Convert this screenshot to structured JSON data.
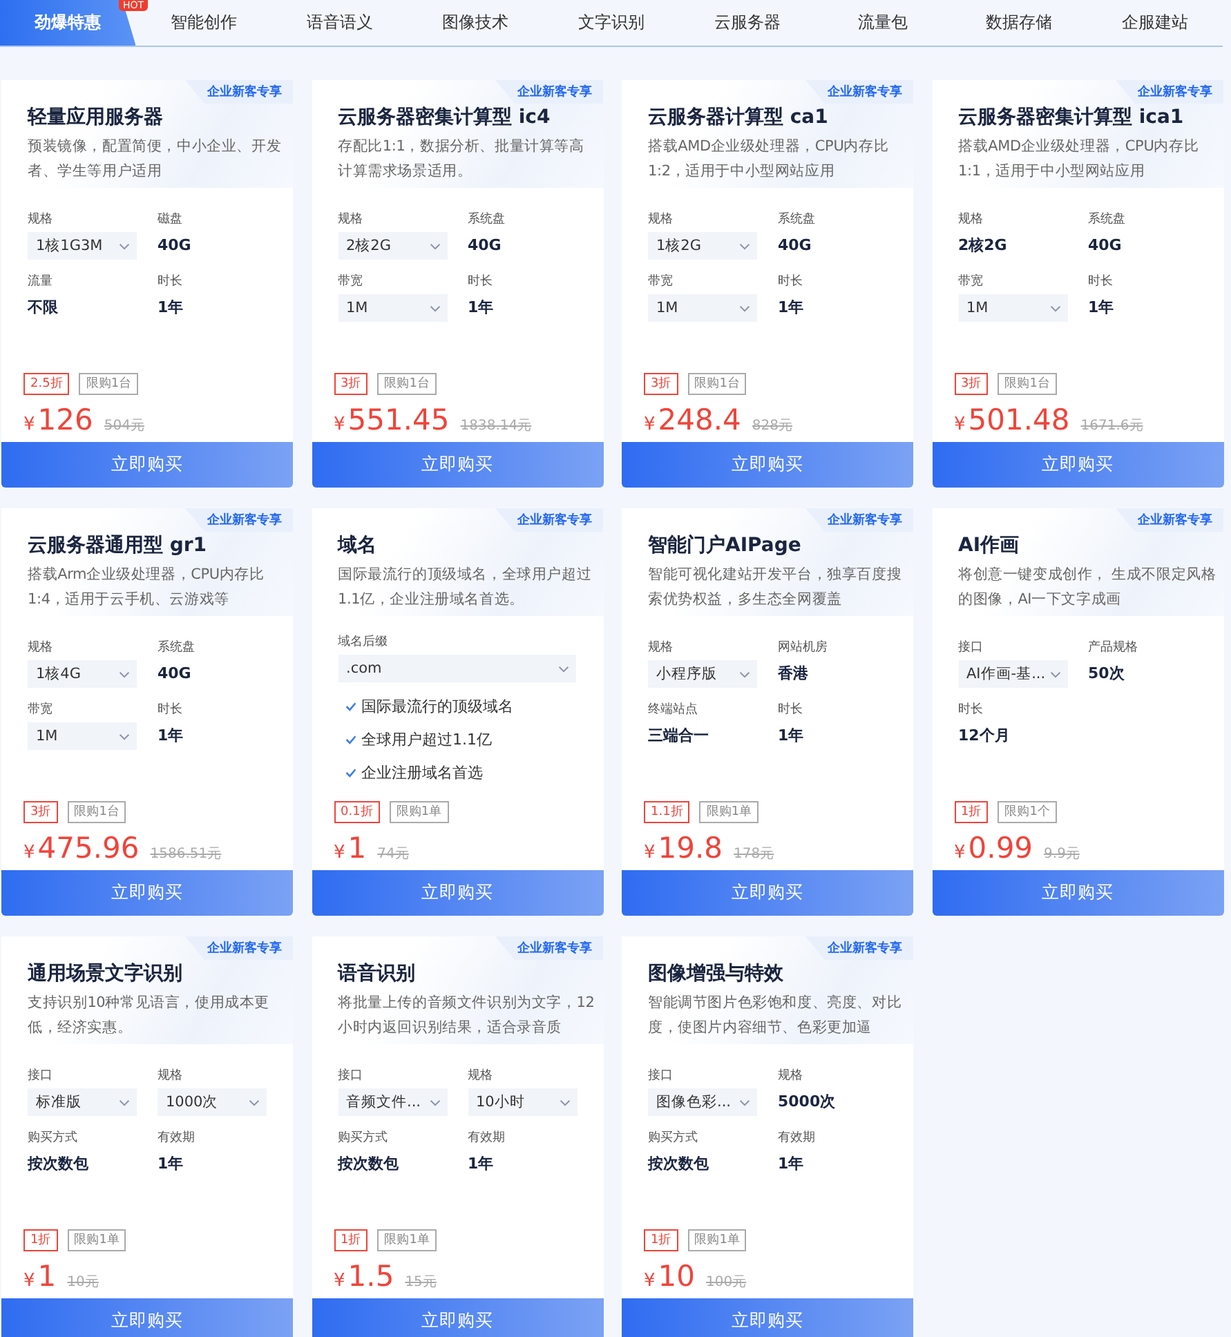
{
  "tabs": [
    {
      "label": "劲爆特惠",
      "selected": true,
      "badge": "HOT"
    },
    {
      "label": "智能创作",
      "selected": false
    },
    {
      "label": "语音语义",
      "selected": false
    },
    {
      "label": "图像技术",
      "selected": false
    },
    {
      "label": "文字识别",
      "selected": false
    },
    {
      "label": "云服务器",
      "selected": false
    },
    {
      "label": "流量包",
      "selected": false
    },
    {
      "label": "数据存储",
      "selected": false
    },
    {
      "label": "企服建站",
      "selected": false
    }
  ],
  "products": [
    {
      "corner_tag": "企业新客专享",
      "title": "轻量应用服务器",
      "description": "预装镜像，配置简便，中小企业、开发者、学生等用户适用",
      "fields": [
        {
          "label": "规格",
          "value": "1核1G3M",
          "kind": "select"
        },
        {
          "label": "磁盘",
          "value": "40G",
          "kind": "text"
        },
        {
          "label": "流量",
          "value": "不限",
          "kind": "text"
        },
        {
          "label": "时长",
          "value": "1年",
          "kind": "text"
        }
      ],
      "discount": "2.5折",
      "limit": "限购1台",
      "currency": "¥",
      "price": "126",
      "original_price": "504元",
      "button": "立即购买"
    },
    {
      "corner_tag": "企业新客专享",
      "title": "云服务器密集计算型 ic4",
      "description": "存配比1:1，数据分析、批量计算等高计算需求场景适用。",
      "fields": [
        {
          "label": "规格",
          "value": "2核2G",
          "kind": "select"
        },
        {
          "label": "系统盘",
          "value": "40G",
          "kind": "text"
        },
        {
          "label": "带宽",
          "value": "1M",
          "kind": "select"
        },
        {
          "label": "时长",
          "value": "1年",
          "kind": "text"
        }
      ],
      "discount": "3折",
      "limit": "限购1台",
      "currency": "¥",
      "price": "551.45",
      "original_price": "1838.14元",
      "button": "立即购买"
    },
    {
      "corner_tag": "企业新客专享",
      "title": "云服务器计算型 ca1",
      "description": "搭载AMD企业级处理器，CPU内存比1:2，适用于中小型网站应用",
      "fields": [
        {
          "label": "规格",
          "value": "1核2G",
          "kind": "select"
        },
        {
          "label": "系统盘",
          "value": "40G",
          "kind": "text"
        },
        {
          "label": "带宽",
          "value": "1M",
          "kind": "select"
        },
        {
          "label": "时长",
          "value": "1年",
          "kind": "text"
        }
      ],
      "discount": "3折",
      "limit": "限购1台",
      "currency": "¥",
      "price": "248.4",
      "original_price": "828元",
      "button": "立即购买"
    },
    {
      "corner_tag": "企业新客专享",
      "title": "云服务器密集计算型 ica1",
      "description": "搭载AMD企业级处理器，CPU内存比1:1，适用于中小型网站应用",
      "fields": [
        {
          "label": "规格",
          "value": "2核2G",
          "kind": "text"
        },
        {
          "label": "系统盘",
          "value": "40G",
          "kind": "text"
        },
        {
          "label": "带宽",
          "value": "1M",
          "kind": "select"
        },
        {
          "label": "时长",
          "value": "1年",
          "kind": "text"
        }
      ],
      "discount": "3折",
      "limit": "限购1台",
      "currency": "¥",
      "price": "501.48",
      "original_price": "1671.6元",
      "button": "立即购买"
    },
    {
      "corner_tag": "企业新客专享",
      "title": "云服务器通用型 gr1",
      "description": "搭载Arm企业级处理器，CPU内存比1:4，适用于云手机、云游戏等",
      "fields": [
        {
          "label": "规格",
          "value": "1核4G",
          "kind": "select"
        },
        {
          "label": "系统盘",
          "value": "40G",
          "kind": "text"
        },
        {
          "label": "带宽",
          "value": "1M",
          "kind": "select"
        },
        {
          "label": "时长",
          "value": "1年",
          "kind": "text"
        }
      ],
      "discount": "3折",
      "limit": "限购1台",
      "currency": "¥",
      "price": "475.96",
      "original_price": "1586.51元",
      "button": "立即购买"
    },
    {
      "corner_tag": "企业新客专享",
      "title": "域名",
      "description": "国际最流行的顶级域名，全球用户超过1.1亿，企业注册域名首选。",
      "fields": [
        {
          "label": "域名后缀",
          "value": ".com",
          "kind": "wide_select"
        }
      ],
      "features": [
        "国际最流行的顶级域名",
        "全球用户超过1.1亿",
        "企业注册域名首选"
      ],
      "discount": "0.1折",
      "limit": "限购1单",
      "currency": "¥",
      "price": "1",
      "original_price": "74元",
      "button": "立即购买"
    },
    {
      "corner_tag": "企业新客专享",
      "title": "智能门户AIPage",
      "description": "智能可视化建站开发平台，独享百度搜索优势权益，多生态全网覆盖",
      "fields": [
        {
          "label": "规格",
          "value": "小程序版",
          "kind": "select"
        },
        {
          "label": "网站机房",
          "value": "香港",
          "kind": "text"
        },
        {
          "label": "终端站点",
          "value": "三端合一",
          "kind": "text"
        },
        {
          "label": "时长",
          "value": "1年",
          "kind": "text"
        }
      ],
      "discount": "1.1折",
      "limit": "限购1单",
      "currency": "¥",
      "price": "19.8",
      "original_price": "178元",
      "button": "立即购买"
    },
    {
      "corner_tag": "企业新客专享",
      "title": "AI作画",
      "description": "将创意一键变成创作， 生成不限定风格的图像，AI一下文字成画",
      "fields": [
        {
          "label": "接口",
          "value": "AI作画-基...",
          "kind": "select"
        },
        {
          "label": "产品规格",
          "value": "50次",
          "kind": "text"
        },
        {
          "label": "时长",
          "value": "12个月",
          "kind": "text"
        }
      ],
      "discount": "1折",
      "limit": "限购1个",
      "currency": "¥",
      "price": "0.99",
      "original_price": "9.9元",
      "button": "立即购买"
    },
    {
      "corner_tag": "企业新客专享",
      "title": "通用场景文字识别",
      "description": "支持识别10种常见语言，使用成本更低，经济实惠。",
      "fields": [
        {
          "label": "接口",
          "value": "标准版",
          "kind": "select"
        },
        {
          "label": "规格",
          "value": "1000次",
          "kind": "select"
        },
        {
          "label": "购买方式",
          "value": "按次数包",
          "kind": "text"
        },
        {
          "label": "有效期",
          "value": "1年",
          "kind": "text"
        }
      ],
      "discount": "1折",
      "limit": "限购1单",
      "currency": "¥",
      "price": "1",
      "original_price": "10元",
      "button": "立即购买"
    },
    {
      "corner_tag": "企业新客专享",
      "title": "语音识别",
      "description": "将批量上传的音频文件识别为文字，12小时内返回识别结果，适合录音质",
      "fields": [
        {
          "label": "接口",
          "value": "音频文件...",
          "kind": "select"
        },
        {
          "label": "规格",
          "value": "10小时",
          "kind": "select"
        },
        {
          "label": "购买方式",
          "value": "按次数包",
          "kind": "text"
        },
        {
          "label": "有效期",
          "value": "1年",
          "kind": "text"
        }
      ],
      "discount": "1折",
      "limit": "限购1单",
      "currency": "¥",
      "price": "1.5",
      "original_price": "15元",
      "button": "立即购买"
    },
    {
      "corner_tag": "企业新客专享",
      "title": "图像增强与特效",
      "description": "智能调节图片色彩饱和度、亮度、对比度，使图片内容细节、色彩更加逼",
      "fields": [
        {
          "label": "接口",
          "value": "图像色彩...",
          "kind": "select"
        },
        {
          "label": "规格",
          "value": "5000次",
          "kind": "text"
        },
        {
          "label": "购买方式",
          "value": "按次数包",
          "kind": "text"
        },
        {
          "label": "有效期",
          "value": "1年",
          "kind": "text"
        }
      ],
      "discount": "1折",
      "limit": "限购1单",
      "currency": "¥",
      "price": "10",
      "original_price": "100元",
      "button": "立即购买"
    }
  ]
}
